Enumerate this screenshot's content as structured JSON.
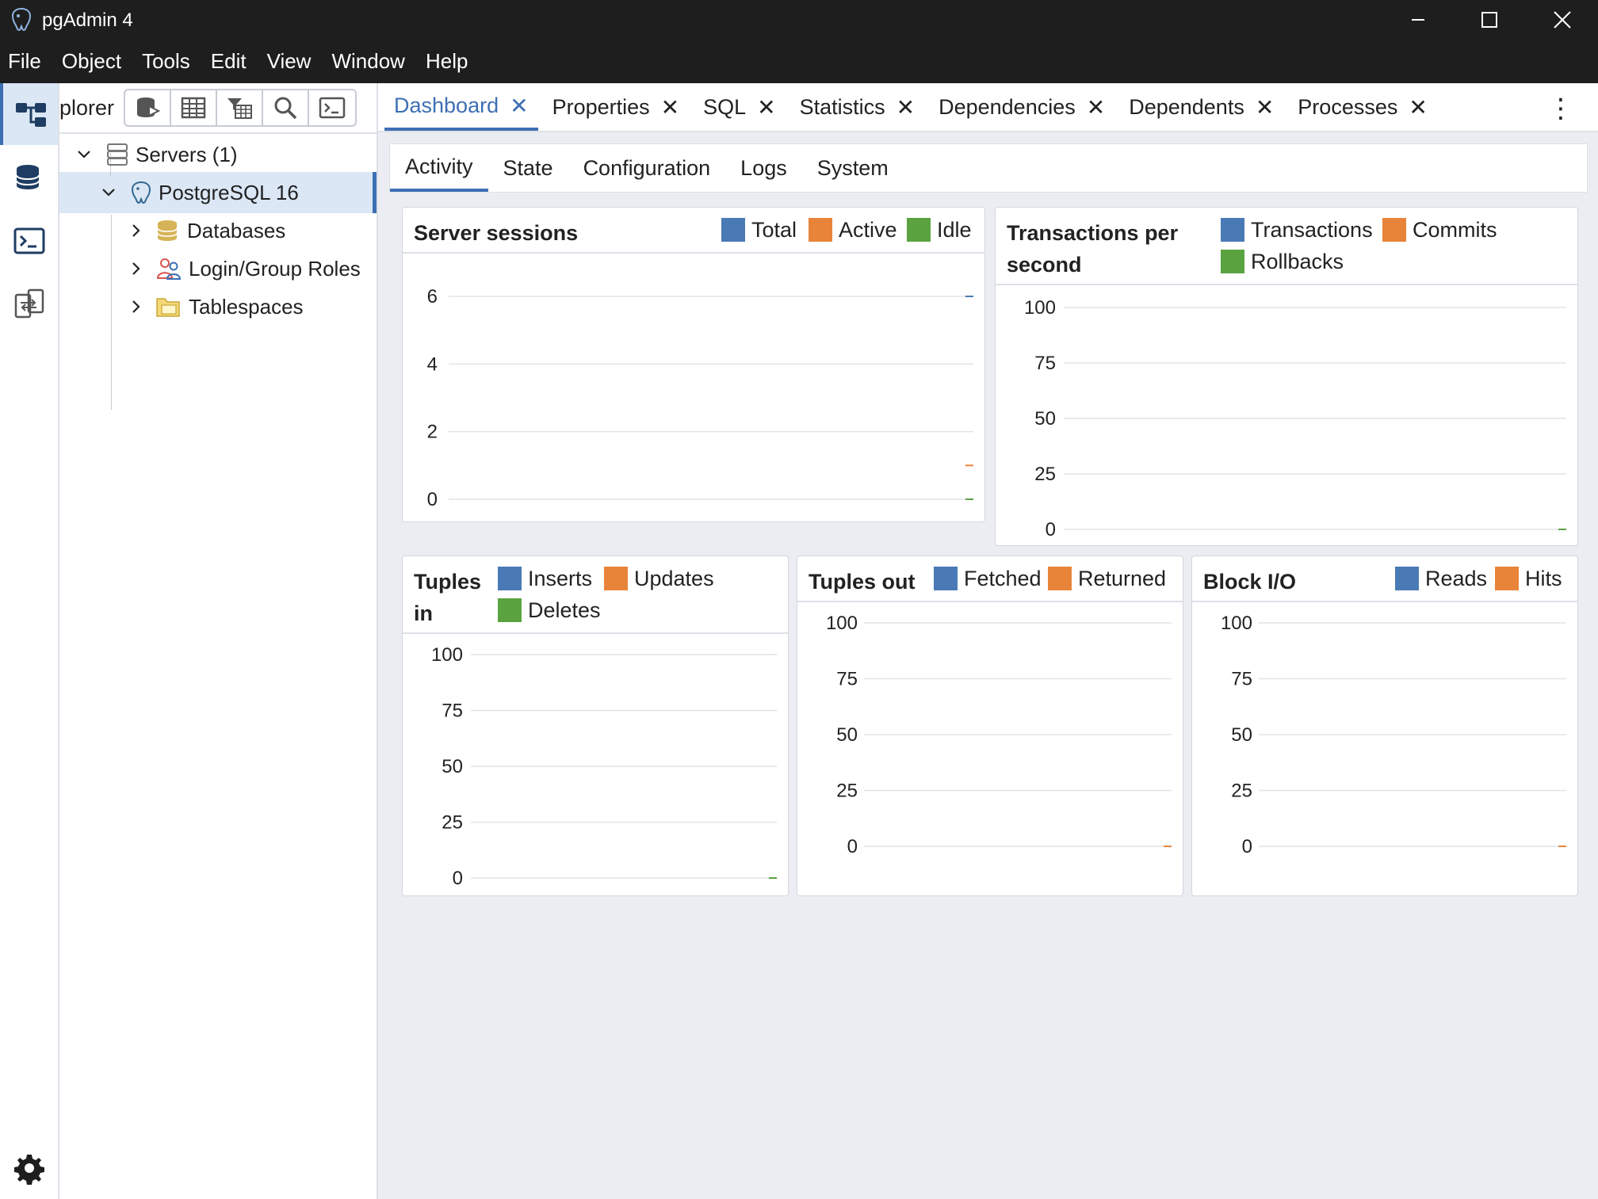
{
  "window": {
    "title": "pgAdmin 4"
  },
  "menu": [
    "File",
    "Object",
    "Tools",
    "Edit",
    "View",
    "Window",
    "Help"
  ],
  "explorer": {
    "label": "plorer",
    "tree": [
      {
        "label": "Servers (1)",
        "level": 0,
        "expanded": true
      },
      {
        "label": "PostgreSQL 16",
        "level": 1,
        "expanded": true,
        "selected": true
      },
      {
        "label": "Databases",
        "level": 2,
        "expanded": false
      },
      {
        "label": "Login/Group Roles",
        "level": 2,
        "expanded": false
      },
      {
        "label": "Tablespaces",
        "level": 2,
        "expanded": false
      }
    ]
  },
  "tabs": [
    "Dashboard",
    "Properties",
    "SQL",
    "Statistics",
    "Dependencies",
    "Dependents",
    "Processes"
  ],
  "active_tab": "Dashboard",
  "subtabs": [
    "Activity",
    "State",
    "Configuration",
    "Logs",
    "System"
  ],
  "active_subtab": "Activity",
  "colors": {
    "blue": "#4a7ab5",
    "orange": "#e8843a",
    "green": "#5aa340",
    "accent": "#3d6fb4"
  },
  "chart_data": [
    {
      "type": "line",
      "title": "Server sessions",
      "yticks": [
        0,
        2,
        4,
        6
      ],
      "ylim": [
        0,
        6
      ],
      "series": [
        {
          "name": "Total",
          "color": "#4a7ab5",
          "values": [
            6
          ]
        },
        {
          "name": "Active",
          "color": "#e8843a",
          "values": [
            1
          ]
        },
        {
          "name": "Idle",
          "color": "#5aa340",
          "values": [
            0
          ]
        }
      ]
    },
    {
      "type": "line",
      "title": "Transactions per second",
      "yticks": [
        0,
        25,
        50,
        75,
        100
      ],
      "ylim": [
        0,
        100
      ],
      "series": [
        {
          "name": "Transactions",
          "color": "#4a7ab5",
          "values": [
            0
          ]
        },
        {
          "name": "Commits",
          "color": "#e8843a",
          "values": [
            0
          ]
        },
        {
          "name": "Rollbacks",
          "color": "#5aa340",
          "values": [
            0
          ]
        }
      ]
    },
    {
      "type": "line",
      "title": "Tuples in",
      "yticks": [
        0,
        25,
        50,
        75,
        100
      ],
      "ylim": [
        0,
        100
      ],
      "series": [
        {
          "name": "Inserts",
          "color": "#4a7ab5",
          "values": [
            0
          ]
        },
        {
          "name": "Updates",
          "color": "#e8843a",
          "values": [
            0
          ]
        },
        {
          "name": "Deletes",
          "color": "#5aa340",
          "values": [
            0
          ]
        }
      ]
    },
    {
      "type": "line",
      "title": "Tuples out",
      "yticks": [
        0,
        25,
        50,
        75,
        100
      ],
      "ylim": [
        0,
        100
      ],
      "series": [
        {
          "name": "Fetched",
          "color": "#4a7ab5",
          "values": [
            0
          ]
        },
        {
          "name": "Returned",
          "color": "#e8843a",
          "values": [
            0
          ]
        }
      ]
    },
    {
      "type": "line",
      "title": "Block I/O",
      "yticks": [
        0,
        25,
        50,
        75,
        100
      ],
      "ylim": [
        0,
        100
      ],
      "series": [
        {
          "name": "Reads",
          "color": "#4a7ab5",
          "values": [
            0
          ]
        },
        {
          "name": "Hits",
          "color": "#e8843a",
          "values": [
            0
          ]
        }
      ]
    }
  ]
}
